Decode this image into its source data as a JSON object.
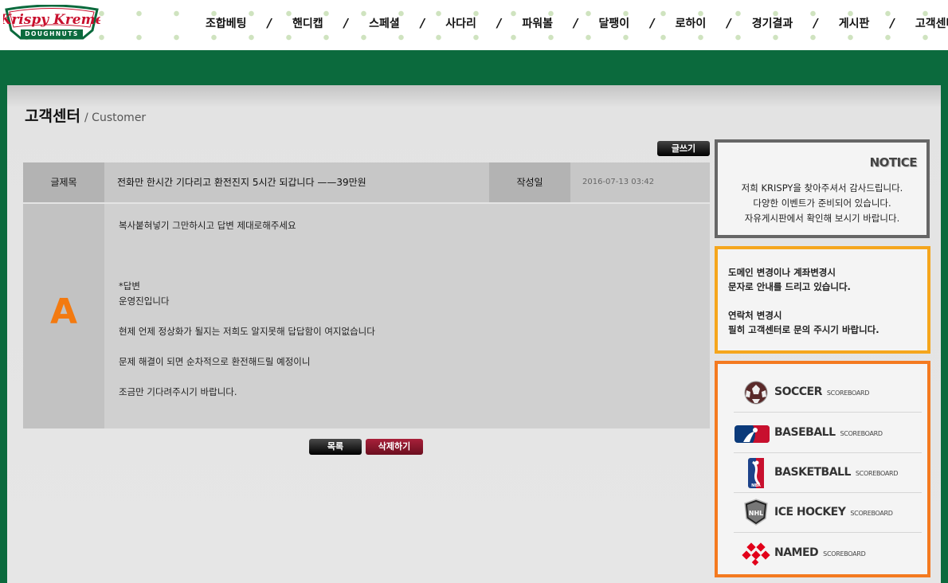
{
  "brand": {
    "logo_line1": "Krispy Kreme",
    "logo_line2": "DOUGHNUTS"
  },
  "nav": [
    {
      "label": "조합베팅"
    },
    {
      "label": "핸디캡"
    },
    {
      "label": "스페셜"
    },
    {
      "label": "사다리"
    },
    {
      "label": "파워볼"
    },
    {
      "label": "달팽이"
    },
    {
      "label": "로하이"
    },
    {
      "label": "경기결과"
    },
    {
      "label": "게시판"
    },
    {
      "label": "고객센터"
    }
  ],
  "nav_separator": "/",
  "page": {
    "title": "고객센터",
    "subtitle": "/ Customer"
  },
  "toolbar": {
    "write_label": "글쓰기"
  },
  "post": {
    "subject_label": "글제목",
    "subject": "전화만 한시간 기다리고 환전진지 5시간 되갑니다 ——39만원",
    "date_label": "작성일",
    "date": "2016-07-13 03:42",
    "answer_marker": "A",
    "body_lines": [
      "복사붙혀넣기 그만하시고 답변 제대로해주세요",
      "",
      "",
      "",
      "*답변",
      "운영진입니다",
      "",
      "현제 언제 정상화가 될지는 저희도 알지못해 답답함이 여지없습니다",
      "",
      "문제 해결이 되면 순차적으로 환전해드릴 예정이니",
      "",
      "조금만 기다려주시기 바랍니다."
    ]
  },
  "actions": {
    "list_label": "목록",
    "delete_label": "삭제하기"
  },
  "notice": {
    "title": "NOTICE",
    "lines": [
      "저희 KRISPY을 찾아주셔서 감사드립니다.",
      "다양한 이벤트가 준비되어 있습니다.",
      "자유게시판에서 확인해 보시기 바랍니다."
    ]
  },
  "info": {
    "lines": [
      "도메인 변경이나 계좌변경시",
      "문자로 안내를 드리고 있습니다.",
      "",
      "연락처 변경시",
      "필히 고객센터로 문의 주시기 바랍니다."
    ]
  },
  "scoreboards": [
    {
      "name": "SOCCER",
      "sub": "SCOREBOARD",
      "icon": "soccer-ball-icon"
    },
    {
      "name": "BASEBALL",
      "sub": "SCOREBOARD",
      "icon": "mlb-logo-icon"
    },
    {
      "name": "BASKETBALL",
      "sub": "SCOREBOARD",
      "icon": "nba-logo-icon"
    },
    {
      "name": "ICE HOCKEY",
      "sub": "SCOREBOARD",
      "icon": "nhl-logo-icon"
    },
    {
      "name": "NAMED",
      "sub": "SCOREBOARD",
      "icon": "named-logo-icon"
    }
  ],
  "colors": {
    "brand_green": "#0b6a3d",
    "answer_orange": "#f37a10",
    "delete_red": "#a8203a",
    "notice_border": "#666666",
    "info_border": "#f5a61d",
    "score_border": "#f47a20"
  }
}
